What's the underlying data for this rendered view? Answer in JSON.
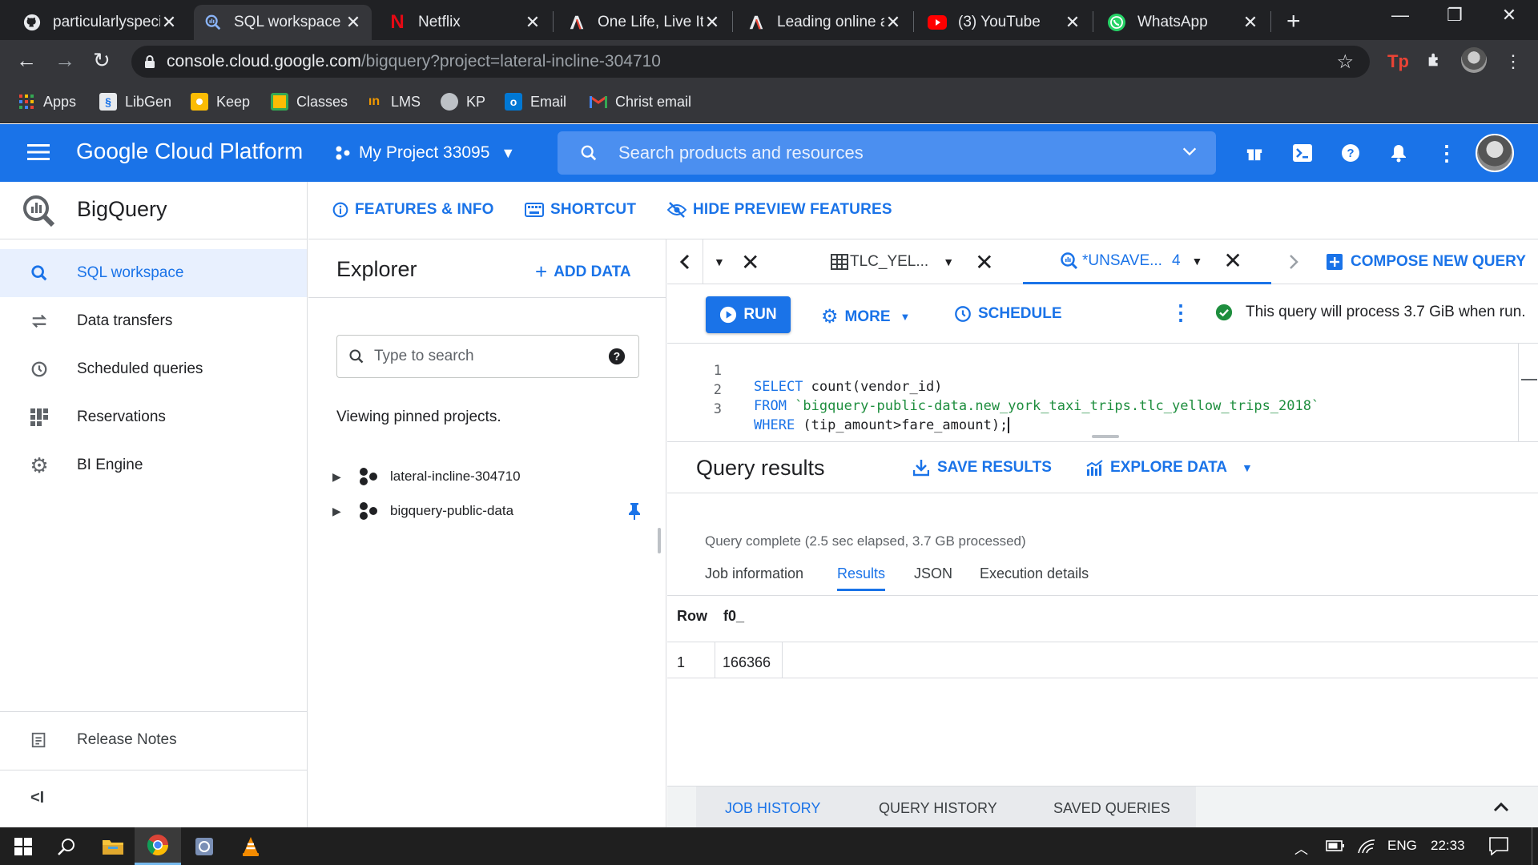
{
  "browser": {
    "tabs": [
      {
        "title": "particularlyspeci",
        "icon": "github-icon"
      },
      {
        "title": "SQL workspace –",
        "icon": "bigquery-icon",
        "active": true
      },
      {
        "title": "Netflix",
        "icon": "netflix-icon"
      },
      {
        "title": "One Life, Live It",
        "icon": "site-icon"
      },
      {
        "title": "Leading online a",
        "icon": "site-icon"
      },
      {
        "title": "(3) YouTube",
        "icon": "youtube-icon"
      },
      {
        "title": "WhatsApp",
        "icon": "whatsapp-icon"
      }
    ],
    "url_host": "console.cloud.google.com",
    "url_path": "/bigquery?project=lateral-incline-304710",
    "bookmarks": [
      {
        "label": "Apps",
        "icon": "apps-grid-icon",
        "color": "#ea4335"
      },
      {
        "label": "LibGen",
        "icon": "book-icon",
        "color": "#4285f4"
      },
      {
        "label": "Keep",
        "icon": "keep-icon",
        "color": "#fbbc04"
      },
      {
        "label": "Classes",
        "icon": "classroom-icon",
        "color": "#34a853"
      },
      {
        "label": "LMS",
        "icon": "lms-icon",
        "color": "#f29900"
      },
      {
        "label": "KP",
        "icon": "kp-icon",
        "color": "#bdc1c6"
      },
      {
        "label": "Email",
        "icon": "outlook-icon",
        "color": "#0078d4"
      },
      {
        "label": "Christ email",
        "icon": "gmail-icon",
        "color": "#ea4335"
      }
    ]
  },
  "header": {
    "brand": "Google Cloud Platform",
    "project": "My Project 33095",
    "search_placeholder": "Search products and resources"
  },
  "leftnav": {
    "title": "BigQuery",
    "items": [
      {
        "label": "SQL workspace",
        "icon": "search-icon",
        "active": true
      },
      {
        "label": "Data transfers",
        "icon": "transfer-icon"
      },
      {
        "label": "Scheduled queries",
        "icon": "clock-icon"
      },
      {
        "label": "Reservations",
        "icon": "reservations-icon"
      },
      {
        "label": "BI Engine",
        "icon": "gear-icon"
      }
    ],
    "release_notes": "Release Notes",
    "collapse": "<I"
  },
  "toolbar": {
    "features": "FEATURES & INFO",
    "shortcut": "SHORTCUT",
    "hide_preview": "HIDE PREVIEW FEATURES"
  },
  "explorer": {
    "title": "Explorer",
    "add_data": "ADD DATA",
    "search_placeholder": "Type to search",
    "viewing": "Viewing pinned projects.",
    "projects": [
      "lateral-incline-304710",
      "bigquery-public-data"
    ]
  },
  "editor_tabs": {
    "table_tab": "TLC_YEL...",
    "query_tab": "*UNSAVE...",
    "query_tab_count": "4",
    "compose": "COMPOSE NEW QUERY"
  },
  "query_toolbar": {
    "run": "RUN",
    "more": "MORE",
    "schedule": "SCHEDULE",
    "validator": "This query will process 3.7 GiB when run."
  },
  "editor": {
    "lines": [
      {
        "n": "1",
        "kw": "SELECT",
        "rest": " count(vendor_id)"
      },
      {
        "n": "2",
        "kw": "FROM",
        "rest": " `bigquery-public-data.new_york_taxi_trips.tlc_yellow_trips_2018`"
      },
      {
        "n": "3",
        "kw": "WHERE",
        "rest": " (tip_amount>fare_amount);"
      }
    ]
  },
  "results": {
    "title": "Query results",
    "save": "SAVE RESULTS",
    "explore": "EXPLORE DATA",
    "status": "Query complete (2.5 sec elapsed, 3.7 GB processed)",
    "tabs": [
      "Job information",
      "Results",
      "JSON",
      "Execution details"
    ],
    "columns": [
      "Row",
      "f0_"
    ],
    "rows": [
      [
        "1",
        "166366"
      ]
    ]
  },
  "history": {
    "tabs": [
      "JOB HISTORY",
      "QUERY HISTORY",
      "SAVED QUERIES"
    ]
  },
  "taskbar": {
    "lang": "ENG",
    "time": "22:33"
  },
  "colors": {
    "accent": "#1a73e8",
    "header_bg": "#1a73e8",
    "success": "#1e8e3e"
  }
}
